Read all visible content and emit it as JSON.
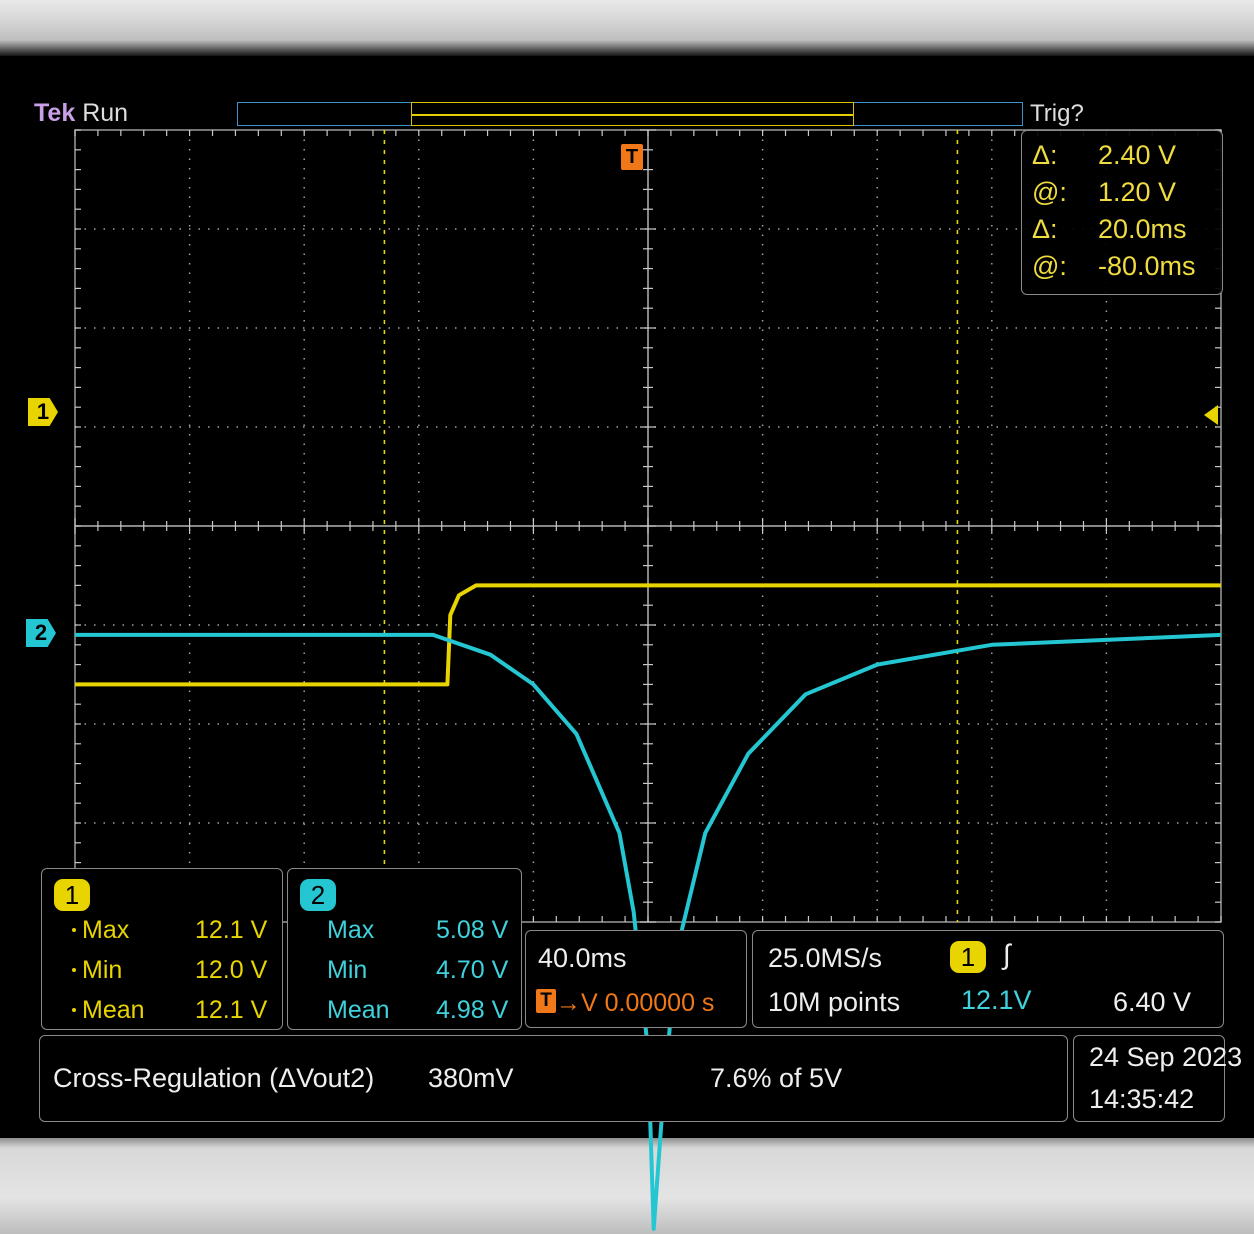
{
  "header": {
    "brand": "Tek",
    "run_state": "Run",
    "trigger_status": "Trig?"
  },
  "markers": {
    "ch1": "1",
    "ch2": "2",
    "trigger": "T"
  },
  "cursors": [
    {
      "key": "Δ:",
      "value": "2.40 V"
    },
    {
      "key": "@:",
      "value": "1.20 V"
    },
    {
      "key": "Δ:",
      "value": "20.0ms"
    },
    {
      "key": "@:",
      "value": "-80.0ms"
    }
  ],
  "measurements": {
    "ch1": {
      "channel": "1",
      "rows": [
        {
          "label": "Max",
          "value": "12.1 V"
        },
        {
          "label": "Min",
          "value": "12.0 V"
        },
        {
          "label": "Mean",
          "value": "12.1 V"
        }
      ]
    },
    "ch2": {
      "channel": "2",
      "rows": [
        {
          "label": "Max",
          "value": "5.08 V"
        },
        {
          "label": "Min",
          "value": "4.70 V"
        },
        {
          "label": "Mean",
          "value": "4.98 V"
        }
      ]
    }
  },
  "horizontal": {
    "scale": "40.0ms",
    "trigger_position": "→V 0.00000 s"
  },
  "acquisition": {
    "sample_rate": "25.0MS/s",
    "record_length": "10M points",
    "trigger_channel": "1",
    "edge_icon": "rising-edge-icon",
    "trigger_level_text": "12.1V",
    "trigger_level": "6.40 V"
  },
  "note": {
    "label": "Cross-Regulation (ΔVout2)",
    "value": "380mV",
    "percent": "7.6% of 5V"
  },
  "datetime": {
    "date": "24 Sep 2023",
    "time": "14:35:42"
  },
  "colors": {
    "ch1": "#e8d400",
    "ch2": "#24c6d2",
    "trigger": "#f07818",
    "grid": "#c8c8c8"
  },
  "chart_data": {
    "type": "line",
    "x_unit": "ms",
    "xlim": [
      -200,
      200
    ],
    "time_per_div": 40,
    "grid": true,
    "series": [
      {
        "channel": "1",
        "x": [
          -200,
          -70,
          -69,
          -66,
          -60,
          0,
          200
        ],
        "y": [
          12.0,
          12.0,
          12.07,
          12.09,
          12.1,
          12.1,
          12.1
        ]
      },
      {
        "channel": "2",
        "x": [
          -200,
          -75,
          -55,
          -40,
          -25,
          -10,
          -5,
          0,
          2,
          5,
          10,
          20,
          35,
          55,
          80,
          120,
          200
        ],
        "y": [
          5.0,
          5.0,
          4.99,
          4.975,
          4.95,
          4.9,
          4.86,
          4.79,
          4.7,
          4.76,
          4.84,
          4.9,
          4.94,
          4.97,
          4.985,
          4.995,
          5.0
        ]
      }
    ]
  }
}
